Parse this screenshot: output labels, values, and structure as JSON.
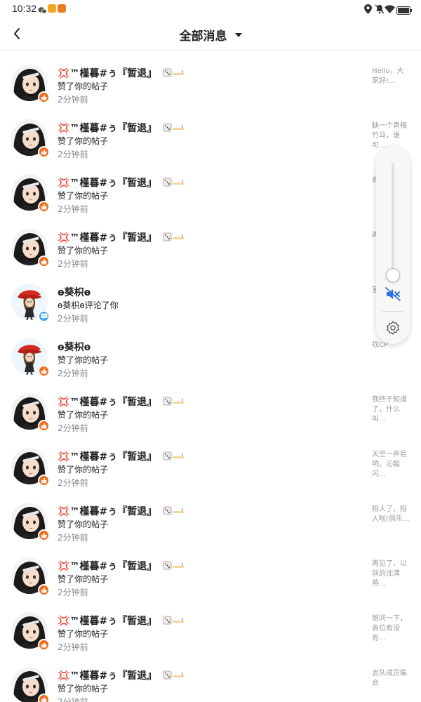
{
  "status_bar": {
    "time": "10:32"
  },
  "header": {
    "title": "全部消息",
    "back_icon": "back-arrow-icon",
    "dropdown_icon": "caret-down-icon"
  },
  "colors": {
    "like_badge": "#f26a1b",
    "comment_badge": "#3aa1f3",
    "mute_icon": "#2f6fe0"
  },
  "messages": [
    {
      "avatar": "anime-girl",
      "badge": "like",
      "name": "💢™槿暮#ぅ『暂退』",
      "action": "赞了你的帖子",
      "time": "2分钟前",
      "preview": "Hello，大家好!..."
    },
    {
      "avatar": "anime-girl",
      "badge": "like",
      "name": "💢™槿暮#ぅ『暂退』",
      "action": "赞了你的帖子",
      "time": "2分钟前",
      "preview": "缺一个青梅竹马，谁可..."
    },
    {
      "avatar": "anime-girl",
      "badge": "like",
      "name": "💢™槿暮#ぅ『暂退』",
      "action": "赞了你的帖子",
      "time": "2分钟前",
      "preview": "有竹"
    },
    {
      "avatar": "anime-girl",
      "badge": "like",
      "name": "💢™槿暮#ぅ『暂退』",
      "action": "赞了你的帖子",
      "time": "2分钟前",
      "preview": "再管的"
    },
    {
      "avatar": "red-hat",
      "badge": "comment",
      "name": "ɵ葵枳ɵ",
      "action": "ɵ葵枳ɵ评论了你",
      "time": "2分钟前",
      "preview": "室"
    },
    {
      "avatar": "red-hat",
      "badge": "like",
      "name": "ɵ葵枳ɵ",
      "action": "赞了你的帖子",
      "time": "2分钟前",
      "preview": "找CP"
    },
    {
      "avatar": "anime-girl",
      "badge": "like",
      "name": "💢™槿暮#ぅ『暂退』",
      "action": "赞了你的帖子",
      "time": "2分钟前",
      "preview": "我终于知道了，什么叫..."
    },
    {
      "avatar": "anime-girl",
      "badge": "like",
      "name": "💢™槿暮#ぅ『暂退』",
      "action": "赞了你的帖子",
      "time": "2分钟前",
      "preview": "天空一声巨响，沁姐闪..."
    },
    {
      "avatar": "anime-girl",
      "badge": "like",
      "name": "💢™槿暮#ぅ『暂退』",
      "action": "赞了你的帖子",
      "time": "2分钟前",
      "preview": "招人了，招人啦(俱乐..."
    },
    {
      "avatar": "anime-girl",
      "badge": "like",
      "name": "💢™槿暮#ぅ『暂退』",
      "action": "赞了你的帖子",
      "time": "2分钟前",
      "preview": "再见了，以前的沈清燕..."
    },
    {
      "avatar": "anime-girl",
      "badge": "like",
      "name": "💢™槿暮#ぅ『暂退』",
      "action": "赞了你的帖子",
      "time": "2分钟前",
      "preview": "想问一下，各位有没有..."
    },
    {
      "avatar": "anime-girl",
      "badge": "like",
      "name": "💢™槿暮#ぅ『暂退』",
      "action": "赞了你的帖子",
      "time": "2分钟前",
      "preview": "言队成员集合"
    }
  ],
  "volume_panel": {
    "level": 0.1,
    "muted": true,
    "mute_icon": "speaker-mute-icon",
    "settings_icon": "gear-icon"
  }
}
